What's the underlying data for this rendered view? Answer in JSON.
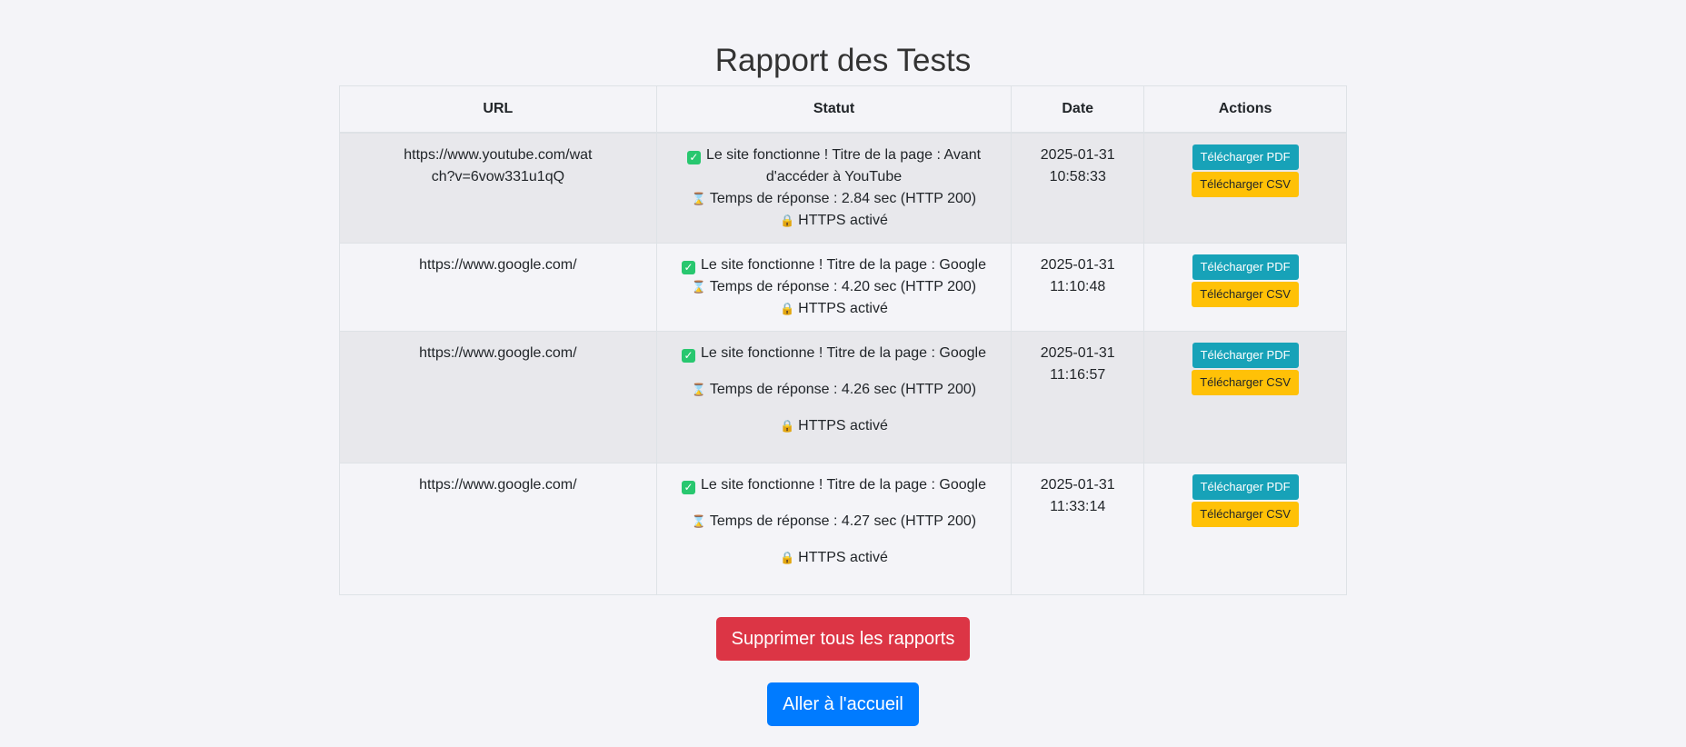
{
  "page": {
    "title": "Rapport des Tests"
  },
  "table": {
    "headers": {
      "url": "URL",
      "status": "Statut",
      "date": "Date",
      "actions": "Actions"
    },
    "rows": [
      {
        "url": "https://www.youtube.com/watch?v=6vow331u1qQ",
        "status_ok": "Le site fonctionne ! Titre de la page : Avant d'accéder à YouTube",
        "response_time": "Temps de réponse : 2.84 sec (HTTP 200)",
        "https": "HTTPS activé",
        "date": "2025-01-31",
        "time": "10:58:33"
      },
      {
        "url": "https://www.google.com/",
        "status_ok": "Le site fonctionne ! Titre de la page : Google",
        "response_time": "Temps de réponse : 4.20 sec (HTTP 200)",
        "https": "HTTPS activé",
        "date": "2025-01-31",
        "time": "11:10:48"
      },
      {
        "url": "https://www.google.com/",
        "status_ok": "Le site fonctionne ! Titre de la page : Google",
        "response_time": "Temps de réponse : 4.26 sec (HTTP 200)",
        "https": "HTTPS activé",
        "date": "2025-01-31",
        "time": "11:16:57"
      },
      {
        "url": "https://www.google.com/",
        "status_ok": "Le site fonctionne ! Titre de la page : Google",
        "response_time": "Temps de réponse : 4.27 sec (HTTP 200)",
        "https": "HTTPS activé",
        "date": "2025-01-31",
        "time": "11:33:14"
      }
    ],
    "buttons": {
      "pdf": "Télécharger PDF",
      "csv": "Télécharger CSV"
    }
  },
  "footer": {
    "delete_all": "Supprimer tous les rapports",
    "home": "Aller à l'accueil"
  },
  "icons": {
    "check": "check-box-icon",
    "time": "hourglass-icon",
    "security": "lock-icon"
  },
  "colors": {
    "pdf": "#17a2b8",
    "csv": "#ffc107",
    "danger": "#dc3545",
    "primary": "#007bff",
    "check": "#28c76f"
  }
}
